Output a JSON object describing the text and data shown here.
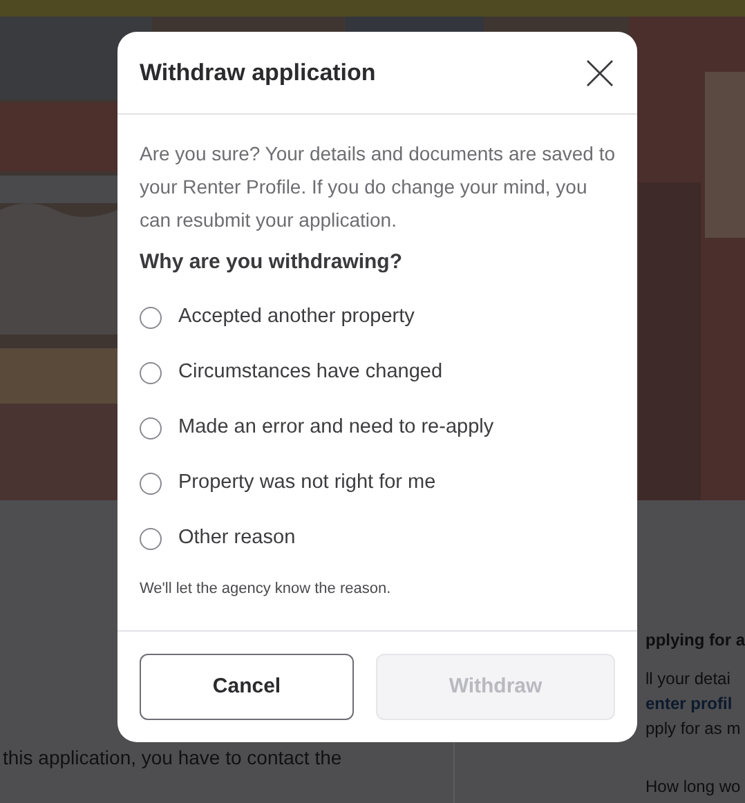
{
  "background": {
    "left_text": "this application, you have to contact the",
    "card": {
      "heading": "pplying for a",
      "line_1": "ll your detai",
      "link": "enter profil",
      "line_2": "pply for as m",
      "question": "How long wo"
    }
  },
  "dialog": {
    "title": "Withdraw application",
    "intro": "Are you sure? Your details and documents are saved to your Renter Profile. If you do change your mind, you can resubmit your application.",
    "question": "Why are you withdrawing?",
    "reasons": [
      {
        "label": "Accepted another property",
        "selected": false
      },
      {
        "label": "Circumstances have changed",
        "selected": false
      },
      {
        "label": "Made an error and need to re-apply",
        "selected": false
      },
      {
        "label": "Property was not right for me",
        "selected": false
      },
      {
        "label": "Other reason",
        "selected": false
      }
    ],
    "note": "We'll let the agency know the reason.",
    "buttons": [
      {
        "label": "Cancel",
        "disabled": false
      },
      {
        "label": "Withdraw",
        "disabled": true
      }
    ]
  }
}
